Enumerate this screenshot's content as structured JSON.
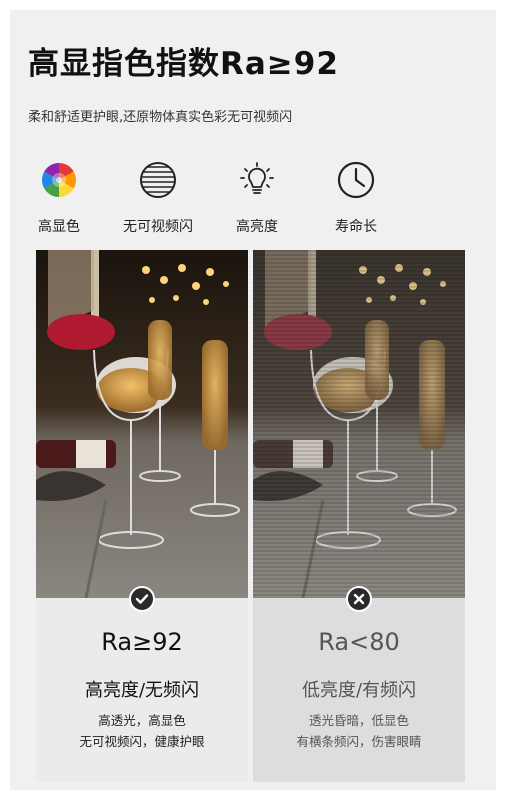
{
  "header": {
    "title": "高显指色指数Ra≥92",
    "subtitle": "柔和舒适更护眼,还原物体真实色彩无可视频闪"
  },
  "features": [
    {
      "icon": "color-wheel-icon",
      "label": "高显色"
    },
    {
      "icon": "stripes-circle-icon",
      "label": "无可视频闪"
    },
    {
      "icon": "light-bulb-icon",
      "label": "高亮度"
    },
    {
      "icon": "clock-icon",
      "label": "寿命长"
    }
  ],
  "comparison": {
    "good": {
      "badge_icon": "check-icon",
      "ra": "Ra≥92",
      "headline": "高亮度/无频闪",
      "line1": "高透光，高显色",
      "line2": "无可视频闪，健康护眼"
    },
    "bad": {
      "badge_icon": "cross-icon",
      "ra": "Ra<80",
      "headline": "低亮度/有频闪",
      "line1": "透光昏暗，低显色",
      "line2": "有横条频闪，伤害眼睛"
    }
  },
  "colors": {
    "background": "#f0f0f0",
    "badge": "#2a2a2a"
  }
}
